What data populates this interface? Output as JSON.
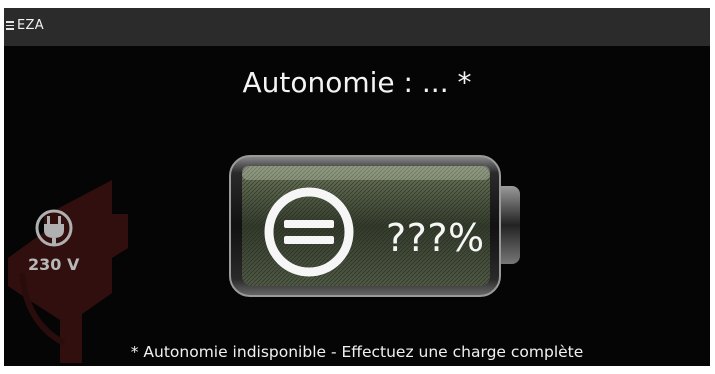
{
  "app": {
    "title": "EZA"
  },
  "autonomy": {
    "headline": "Autonomie :  ... *",
    "percent": "???%",
    "note": "* Autonomie indisponible - Effectuez une charge complète"
  },
  "plug": {
    "voltage": "230 V"
  },
  "icons": {
    "menu": "menu-icon",
    "battery": "battery-icon",
    "status": "equals-circle-icon",
    "plug": "plug-icon"
  },
  "colors": {
    "topbar": "#2b2b2b",
    "background": "#050505",
    "logo": "#3a1212"
  }
}
